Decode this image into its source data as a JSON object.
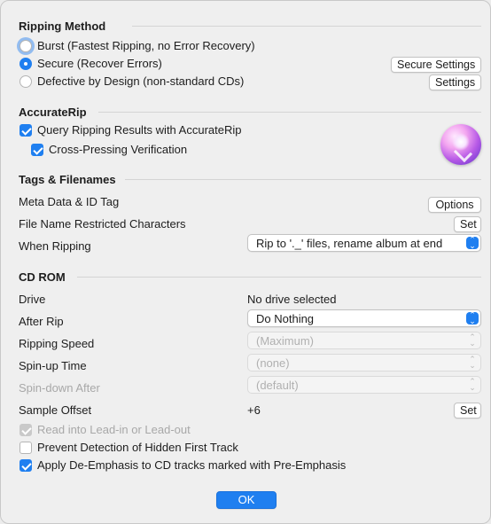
{
  "ripping_method": {
    "title": "Ripping Method",
    "burst": "Burst (Fastest Ripping, no Error Recovery)",
    "secure": "Secure (Recover Errors)",
    "secure_settings_button": "Secure Settings",
    "defective": "Defective by Design (non-standard CDs)",
    "settings_button": "Settings",
    "selected": "secure"
  },
  "accuraterip": {
    "title": "AccurateRip",
    "query": "Query Ripping Results with AccurateRip",
    "query_checked": true,
    "cross_pressing": "Cross-Pressing Verification",
    "cross_pressing_checked": true
  },
  "tags": {
    "title": "Tags & Filenames",
    "meta_label": "Meta Data & ID Tag",
    "options_button": "Options",
    "restricted_label": "File Name Restricted Characters",
    "set_button": "Set",
    "when_ripping_label": "When Ripping",
    "when_ripping_value": "Rip to '._' files, rename album at end"
  },
  "cdrom": {
    "title": "CD ROM",
    "drive_label": "Drive",
    "drive_value": "No drive selected",
    "after_rip_label": "After Rip",
    "after_rip_value": "Do Nothing",
    "speed_label": "Ripping Speed",
    "speed_value": "(Maximum)",
    "spinup_label": "Spin-up Time",
    "spinup_value": "(none)",
    "spindown_label": "Spin-down After",
    "spindown_value": "(default)",
    "offset_label": "Sample Offset",
    "offset_value": "+6",
    "offset_set_button": "Set",
    "leadin_label": "Read into Lead-in or Lead-out",
    "leadin_checked": true,
    "hidden_track_label": "Prevent Detection of Hidden First Track",
    "hidden_track_checked": false,
    "deemphasis_label": "Apply De-Emphasis to CD tracks marked with Pre-Emphasis",
    "deemphasis_checked": true
  },
  "footer": {
    "ok_button": "OK"
  },
  "colors": {
    "accent": "#1f7ff0",
    "background": "#efefef",
    "disabled_text": "#a8a8a8"
  }
}
